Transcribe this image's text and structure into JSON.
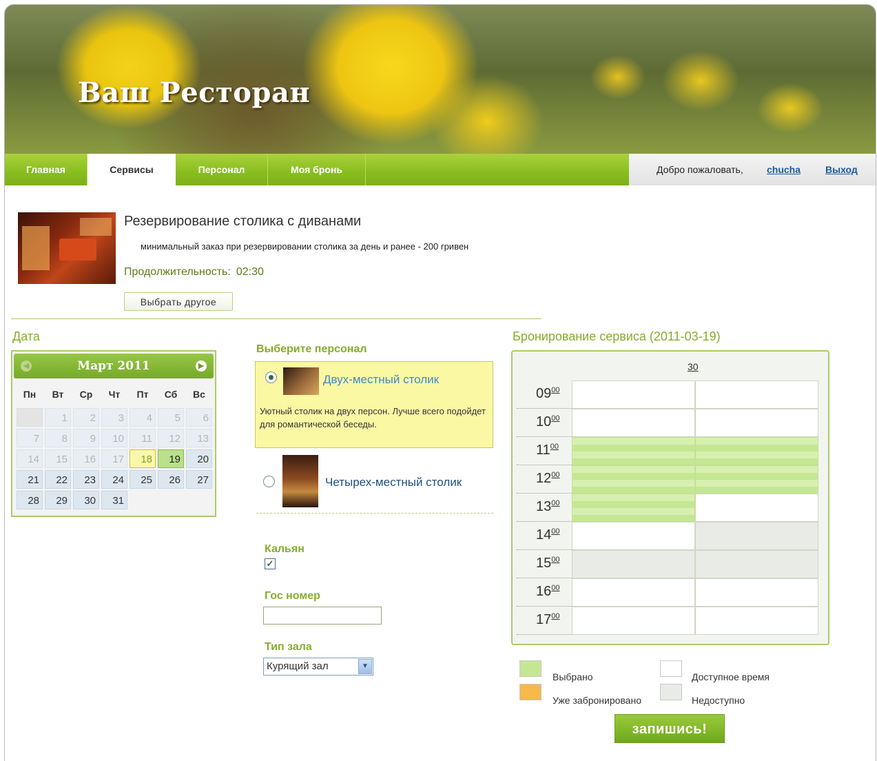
{
  "site": {
    "title": "Ваш Ресторан"
  },
  "nav": {
    "tabs": [
      {
        "label": "Главная"
      },
      {
        "label": "Сервисы"
      },
      {
        "label": "Персонал"
      },
      {
        "label": "Моя бронь"
      }
    ],
    "active": "Сервисы",
    "welcome": "Добро пожаловать,",
    "username": "chucha",
    "logout": "Выход"
  },
  "service": {
    "title": "Резервирование столика с диванами",
    "note": "минимальный заказ при резервировании столика за день и ранее - 200 гривен",
    "duration_label": "Продолжительность:",
    "duration_value": "02:30",
    "choose_other": "Выбрать другое"
  },
  "date_section": {
    "title": "Дата",
    "month": "Март 2011",
    "prev_icon": "chevron-left-icon",
    "next_icon": "chevron-right-icon",
    "weekdays": [
      "Пн",
      "Вт",
      "Ср",
      "Чт",
      "Пт",
      "Сб",
      "Вс"
    ],
    "weeks": [
      [
        "",
        "1",
        "2",
        "3",
        "4",
        "5",
        "6"
      ],
      [
        "7",
        "8",
        "9",
        "10",
        "11",
        "12",
        "13"
      ],
      [
        "14",
        "15",
        "16",
        "17",
        "18",
        "19",
        "20"
      ],
      [
        "21",
        "22",
        "23",
        "24",
        "25",
        "26",
        "27"
      ],
      [
        "28",
        "29",
        "30",
        "31",
        "",
        "",
        ""
      ]
    ],
    "today": "18",
    "selected": "19",
    "first_available": 19
  },
  "staff_section": {
    "title": "Выберите персонал",
    "options": [
      {
        "name": "Двух-местный столик",
        "description": "Уютный столик на двух персон. Лучше всего подойдет для романтической беседы.",
        "selected": true
      },
      {
        "name": "Четырех-местный столик",
        "description": "",
        "selected": false
      }
    ]
  },
  "extras": {
    "hookah_label": "Кальян",
    "hookah_checked": true,
    "plate_label": "Гос номер",
    "plate_value": "",
    "hall_label": "Тип зала",
    "hall_value": "Курящий зал"
  },
  "booking": {
    "title": "Бронирование сервиса (2011-03-19)",
    "column_label": "30",
    "minutes": "00",
    "hours": [
      "09",
      "10",
      "11",
      "12",
      "13",
      "14",
      "15",
      "16",
      "17"
    ],
    "slots": [
      [
        "free",
        "free"
      ],
      [
        "free",
        "free"
      ],
      [
        "sel",
        "sel"
      ],
      [
        "sel",
        "sel"
      ],
      [
        "sel",
        "free"
      ],
      [
        "free",
        "na"
      ],
      [
        "na",
        "na"
      ],
      [
        "free",
        "free"
      ],
      [
        "free",
        "free"
      ]
    ]
  },
  "legend": {
    "selected": {
      "label": "Выбрано",
      "color": "#c5e794"
    },
    "booked": {
      "label": "Уже забронировано",
      "color": "#f6b94a"
    },
    "available": {
      "label": "Доступное время",
      "color": "#ffffff"
    },
    "unavailable": {
      "label": "Недоступно",
      "color": "#e9ebe6"
    }
  },
  "submit_label": "запишись!"
}
